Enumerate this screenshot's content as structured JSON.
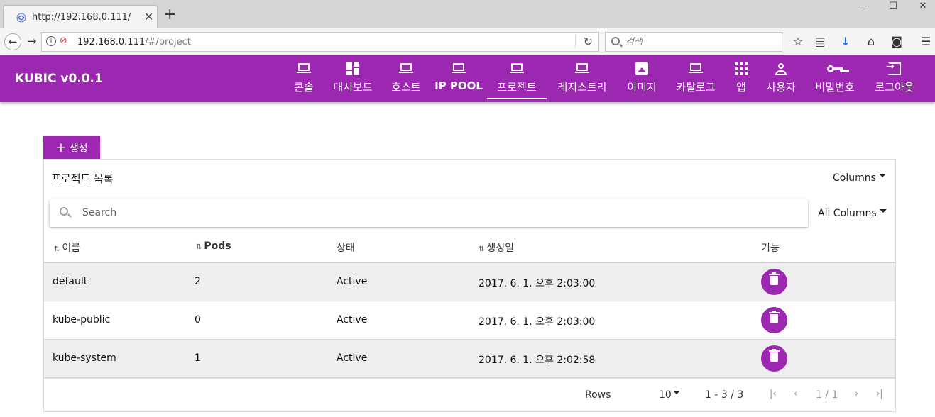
{
  "browser": {
    "tab_title": "http://192.168.0.111/",
    "new_tab": "+",
    "url_host": "192.168.0.111",
    "url_path": "/#/project",
    "search_placeholder": "검색"
  },
  "app": {
    "brand": "KUBIC v0.0.1",
    "menu": [
      {
        "label": "콘솔",
        "icon": "laptop-icon"
      },
      {
        "label": "대시보드",
        "icon": "dashboard-icon"
      },
      {
        "label": "호스트",
        "icon": "laptop-icon"
      },
      {
        "label": "IP POOL",
        "icon": "laptop-icon"
      },
      {
        "label": "프로젝트",
        "icon": "laptop-icon"
      },
      {
        "label": "레지스트리",
        "icon": "laptop-icon"
      },
      {
        "label": "이미지",
        "icon": "image-icon"
      },
      {
        "label": "카탈로그",
        "icon": "laptop-icon"
      },
      {
        "label": "앱",
        "icon": "apps-icon"
      },
      {
        "label": "사용자",
        "icon": "user-icon"
      },
      {
        "label": "비밀번호",
        "icon": "key-icon"
      },
      {
        "label": "로그아웃",
        "icon": "exit-icon"
      }
    ],
    "active_menu": "프로젝트",
    "accent": "#9c27b0"
  },
  "content": {
    "create_label": "생성",
    "panel_title": "프로젝트 목록",
    "columns_label": "Columns",
    "all_columns_label": "All Columns",
    "search_placeholder": "Search",
    "table": {
      "headers": [
        "이름",
        "Pods",
        "상태",
        "생성일",
        "기능"
      ],
      "rows": [
        {
          "name": "default",
          "pods": "2",
          "status": "Active",
          "created": "2017. 6. 1. 오후 2:03:00"
        },
        {
          "name": "kube-public",
          "pods": "0",
          "status": "Active",
          "created": "2017. 6. 1. 오후 2:03:00"
        },
        {
          "name": "kube-system",
          "pods": "1",
          "status": "Active",
          "created": "2017. 6. 1. 오후 2:02:58"
        }
      ]
    },
    "pagination": {
      "rows_label": "Rows",
      "rows_per_page": "10",
      "range": "1 - 3 / 3",
      "page": "1 / 1"
    }
  }
}
